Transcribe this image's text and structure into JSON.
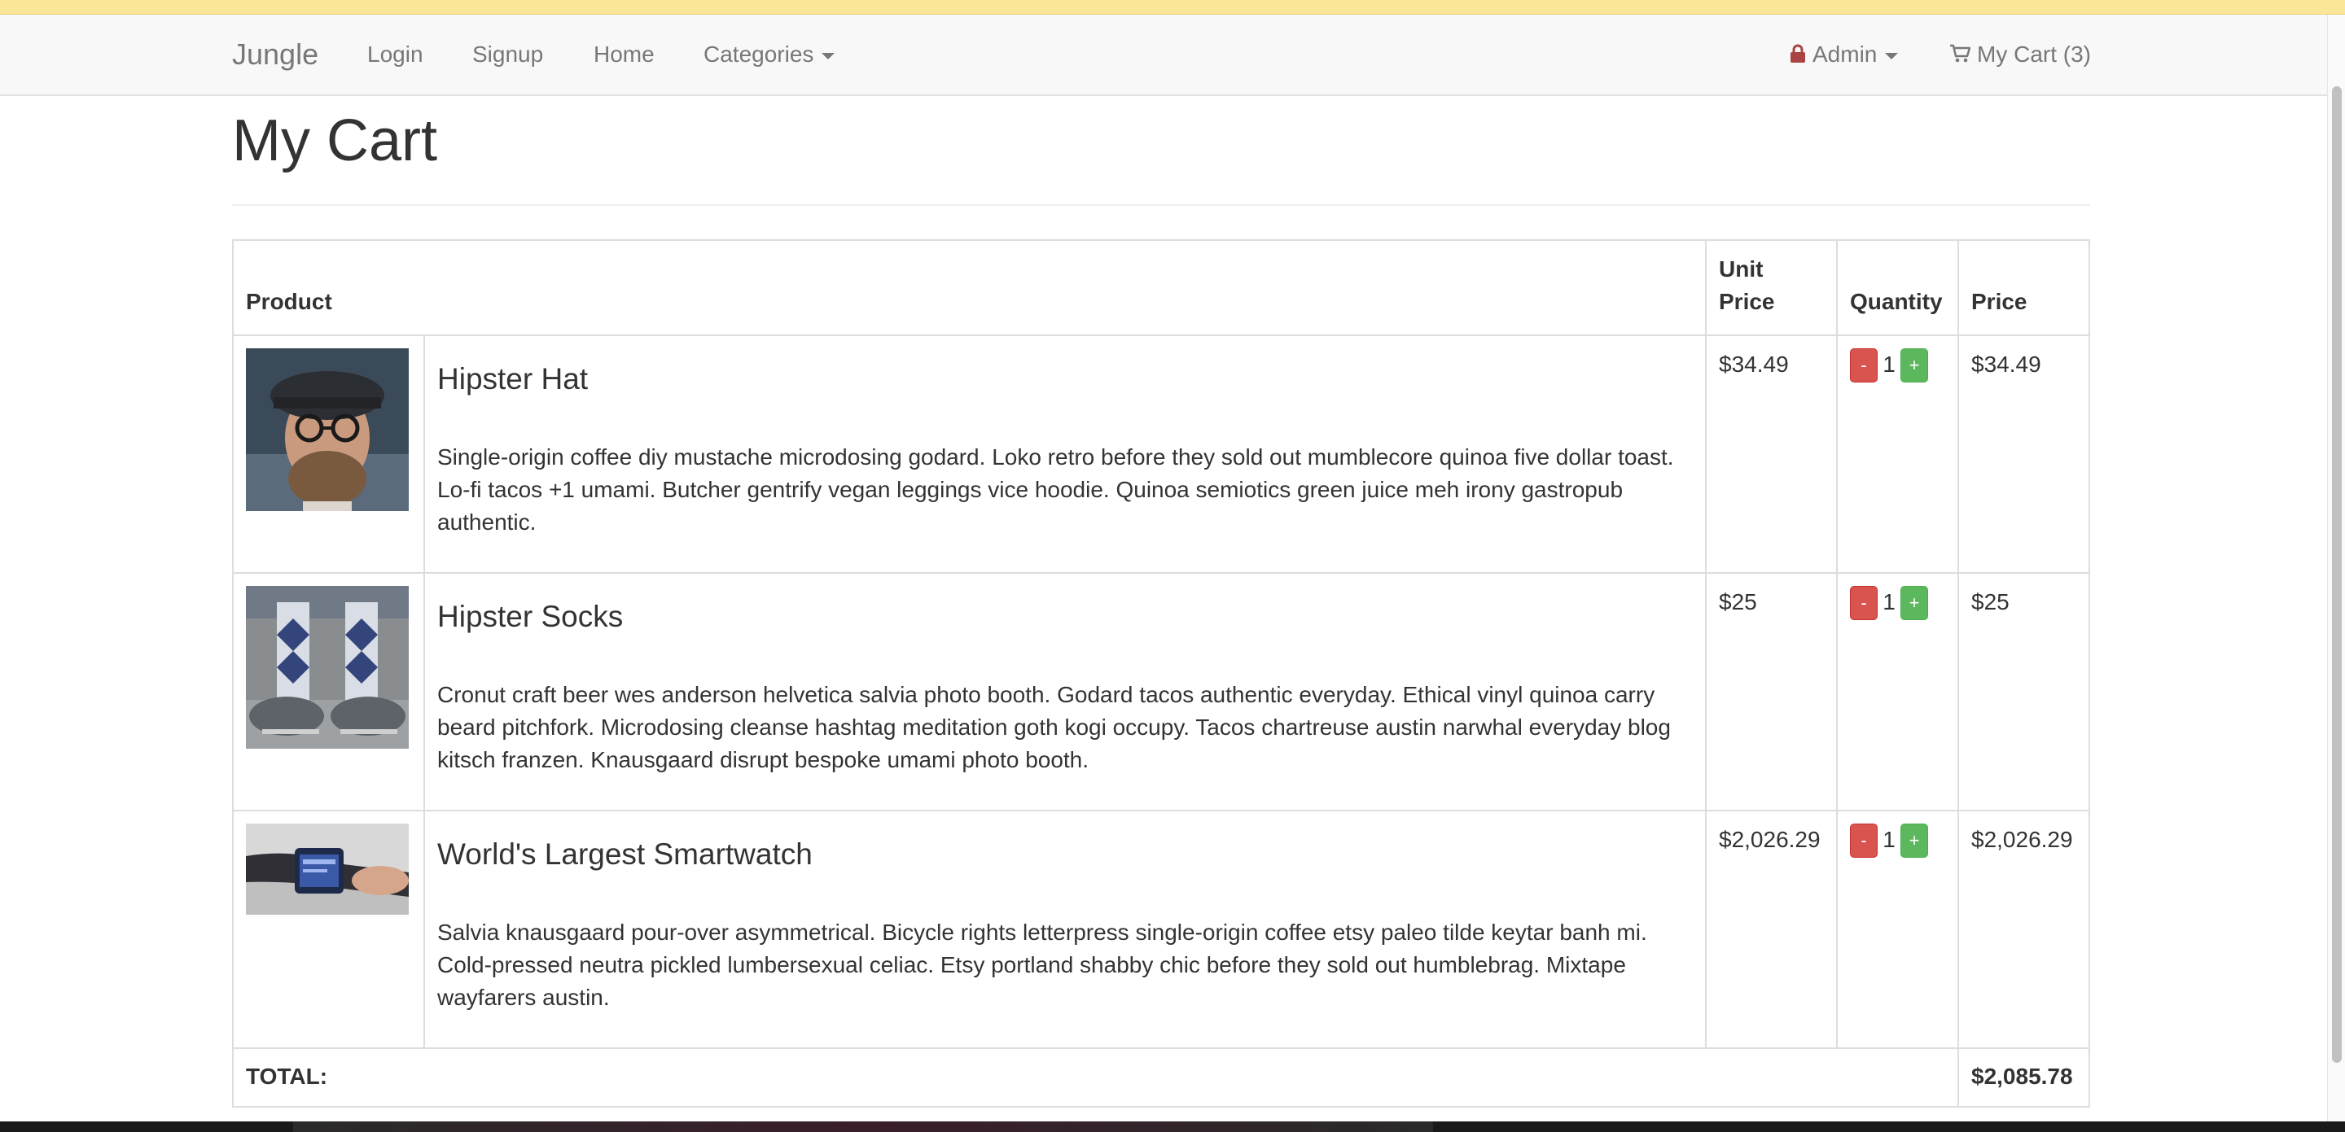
{
  "navbar": {
    "brand": "Jungle",
    "links": [
      "Login",
      "Signup",
      "Home"
    ],
    "categories_label": "Categories",
    "admin_label": "Admin",
    "cart_label": "My Cart (3)"
  },
  "page": {
    "title": "My Cart"
  },
  "table": {
    "headers": {
      "product": "Product",
      "unit_price": "Unit Price",
      "quantity": "Quantity",
      "price": "Price"
    },
    "items": [
      {
        "name": "Hipster Hat",
        "description": "Single-origin coffee diy mustache microdosing godard. Loko retro before they sold out mumblecore quinoa five dollar toast. Lo-fi tacos +1 umami. Butcher gentrify vegan leggings vice hoodie. Quinoa semiotics green juice meh irony gastropub authentic.",
        "unit_price": "$34.49",
        "quantity": "1",
        "price": "$34.49"
      },
      {
        "name": "Hipster Socks",
        "description": "Cronut craft beer wes anderson helvetica salvia photo booth. Godard tacos authentic everyday. Ethical vinyl quinoa carry beard pitchfork. Microdosing cleanse hashtag meditation goth kogi occupy. Tacos chartreuse austin narwhal everyday blog kitsch franzen. Knausgaard disrupt bespoke umami photo booth.",
        "unit_price": "$25",
        "quantity": "1",
        "price": "$25"
      },
      {
        "name": "World's Largest Smartwatch",
        "description": "Salvia knausgaard pour-over asymmetrical. Bicycle rights letterpress single-origin coffee etsy paleo tilde keytar banh mi. Cold-pressed neutra pickled lumbersexual celiac. Etsy portland shabby chic before they sold out humblebrag. Mixtape wayfarers austin.",
        "unit_price": "$2,026.29",
        "quantity": "1",
        "price": "$2,026.29"
      }
    ],
    "minus_label": "-",
    "plus_label": "+",
    "total_label": "TOTAL:",
    "total_value": "$2,085.78"
  },
  "colors": {
    "danger": "#d9534f",
    "success": "#5cb85c",
    "admin_text": "#a94442",
    "navbar_bg": "#f8f8f8",
    "top_strip": "#fbe597"
  }
}
